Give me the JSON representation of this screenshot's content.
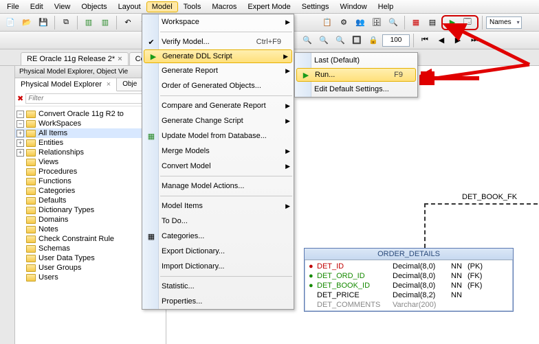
{
  "menubar": [
    "File",
    "Edit",
    "View",
    "Objects",
    "Layout",
    "Model",
    "Tools",
    "Macros",
    "Expert Mode",
    "Settings",
    "Window",
    "Help"
  ],
  "menubar_open_index": 5,
  "toolbar2": {
    "zoom": "100"
  },
  "names_combo": "Names",
  "tabs": [
    {
      "label": "RE Oracle 11g Release 2*",
      "closable": true
    },
    {
      "label": "Co",
      "closable": false
    }
  ],
  "panel_header": "Physical Model Explorer, Object Vie",
  "subtabs": [
    {
      "label": "Physical Model Explorer",
      "closable": true,
      "active": true
    },
    {
      "label": "Obje",
      "closable": false,
      "active": false
    }
  ],
  "filter_placeholder": "Filter",
  "tree": {
    "root": "Convert Oracle 11g R2 to",
    "items": [
      "WorkSpaces",
      "All Items",
      "Entities",
      "Relationships",
      "Views",
      "Procedures",
      "Functions",
      "Categories",
      "Defaults",
      "Dictionary Types",
      "Domains",
      "Notes",
      "Check Constraint Rule",
      "Schemas",
      "User Data Types",
      "User Groups",
      "Users"
    ]
  },
  "model_menu": {
    "items": [
      {
        "label": "Workspace",
        "sub": true
      },
      {
        "sep": true
      },
      {
        "label": "Verify Model...",
        "shortcut": "Ctrl+F9",
        "icon": "check"
      },
      {
        "label": "Generate DDL Script",
        "sub": true,
        "hl": true,
        "icon": "play"
      },
      {
        "label": "Generate Report",
        "sub": true
      },
      {
        "label": "Order of Generated Objects..."
      },
      {
        "sep": true
      },
      {
        "label": "Compare and Generate Report",
        "sub": true
      },
      {
        "label": "Generate Change Script",
        "sub": true
      },
      {
        "label": "Update Model from Database...",
        "icon": "db"
      },
      {
        "label": "Merge Models",
        "sub": true
      },
      {
        "label": "Convert Model",
        "sub": true
      },
      {
        "sep": true
      },
      {
        "label": "Manage Model Actions..."
      },
      {
        "sep": true
      },
      {
        "label": "Model Items",
        "sub": true
      },
      {
        "label": "To Do..."
      },
      {
        "label": "Categories...",
        "icon": "grid"
      },
      {
        "label": "Export Dictionary..."
      },
      {
        "label": "Import Dictionary..."
      },
      {
        "sep": true
      },
      {
        "label": "Statistic..."
      },
      {
        "label": "Properties..."
      }
    ]
  },
  "sub_menu": {
    "items": [
      {
        "label": "Last (Default)"
      },
      {
        "label": "Run...",
        "shortcut": "F9",
        "hl": true,
        "icon": "play"
      },
      {
        "label": "Edit Default Settings..."
      }
    ]
  },
  "fk_label": "DET_BOOK_FK",
  "entity": {
    "title": "ORDER_DETAILS",
    "cols": [
      {
        "name": "DET_ID",
        "type": "Decimal(8,0)",
        "nn": "NN",
        "key": "(PK)",
        "cls": "red",
        "bullet": "red"
      },
      {
        "name": "DET_ORD_ID",
        "type": "Decimal(8,0)",
        "nn": "NN",
        "key": "(FK)",
        "cls": "green",
        "bullet": "green"
      },
      {
        "name": "DET_BOOK_ID",
        "type": "Decimal(8,0)",
        "nn": "NN",
        "key": "(FK)",
        "cls": "green",
        "bullet": "green"
      },
      {
        "name": "DET_PRICE",
        "type": "Decimal(8,2)",
        "nn": "NN",
        "key": "",
        "cls": "",
        "bullet": ""
      },
      {
        "name": "DET_COMMENTS",
        "type": "Varchar(200)",
        "nn": "",
        "key": "",
        "cls": "gray",
        "bullet": ""
      }
    ]
  }
}
